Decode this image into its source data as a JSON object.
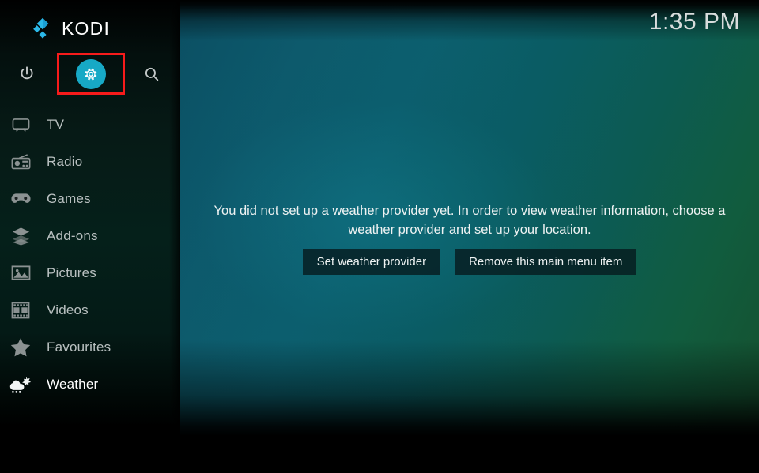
{
  "app": {
    "name": "KODI",
    "logo_icon": "kodi-diamond-logo-icon"
  },
  "clock": {
    "time": "1:35 PM"
  },
  "toolbar": {
    "power_label": "Power",
    "power_icon": "power-icon",
    "settings_label": "Settings",
    "settings_icon": "gear-icon",
    "search_label": "Search",
    "search_icon": "search-icon",
    "highlight_color": "#f71b1b"
  },
  "sidebar": {
    "items": [
      {
        "label": "TV",
        "icon": "tv-icon",
        "selected": false
      },
      {
        "label": "Radio",
        "icon": "radio-icon",
        "selected": false
      },
      {
        "label": "Games",
        "icon": "gamepad-icon",
        "selected": false
      },
      {
        "label": "Add-ons",
        "icon": "addons-box-icon",
        "selected": false
      },
      {
        "label": "Pictures",
        "icon": "pictures-icon",
        "selected": false
      },
      {
        "label": "Videos",
        "icon": "film-strip-icon",
        "selected": false
      },
      {
        "label": "Favourites",
        "icon": "star-icon",
        "selected": false
      },
      {
        "label": "Weather",
        "icon": "weather-cloud-sun-rain-icon",
        "selected": true
      }
    ]
  },
  "main": {
    "message": "You did not set up a weather provider yet. In order to view weather information, choose a weather provider and set up your location.",
    "buttons": [
      {
        "label": "Set weather provider"
      },
      {
        "label": "Remove this main menu item"
      }
    ]
  },
  "colors": {
    "accent_teal": "#17a9c6",
    "logo_blue": "#2bb8e8",
    "highlight_red": "#f71b1b",
    "background_teal": "#0c5f6e"
  }
}
